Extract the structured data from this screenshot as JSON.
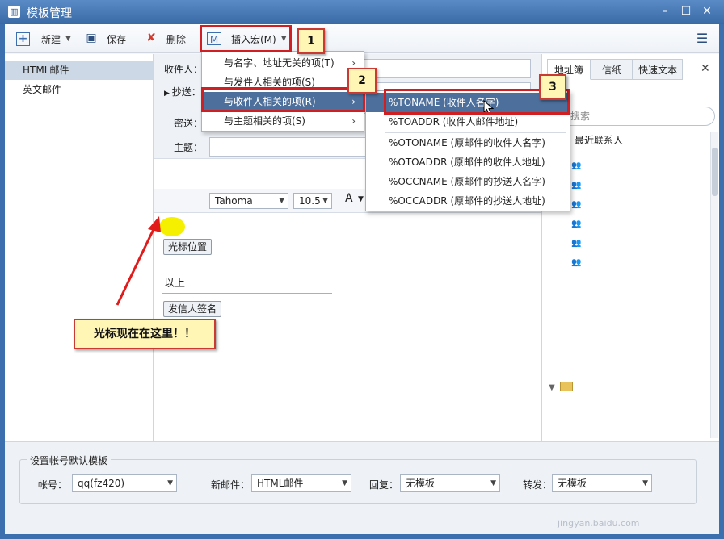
{
  "window": {
    "title": "模板管理"
  },
  "toolbar": {
    "new_label": "新建",
    "save_label": "保存",
    "delete_label": "删除",
    "insert_macro_label": "插入宏(M)"
  },
  "sidebar": {
    "items": [
      {
        "label": "HTML邮件"
      },
      {
        "label": "英文邮件"
      }
    ]
  },
  "compose": {
    "to_label": "收件人：",
    "cc_label": "抄送：",
    "bcc_label": "密送：",
    "subject_label": "主题：",
    "font_name": "Tahoma",
    "font_size": "10.5",
    "cursor_chip": "光标位置",
    "body_text": "以上",
    "signature_chip": "发信人签名"
  },
  "insert_menu": {
    "items": [
      {
        "label": "与名字、地址无关的项(T)"
      },
      {
        "label": "与发件人相关的项(S)"
      },
      {
        "label": "与收件人相关的项(R)"
      },
      {
        "label": "与主题相关的项(S)"
      }
    ]
  },
  "submenu": {
    "items": [
      {
        "label": "%TONAME (收件人名字)"
      },
      {
        "label": "%TOADDR (收件人邮件地址)"
      },
      {
        "label": "%OTONAME (原邮件的收件人名字)"
      },
      {
        "label": "%OTOADDR (原邮件的收件人地址)"
      },
      {
        "label": "%OCCNAME (原邮件的抄送人名字)"
      },
      {
        "label": "%OCCADDR (原邮件的抄送人地址)"
      }
    ]
  },
  "addressbook": {
    "tabs": [
      {
        "label": "地址簿"
      },
      {
        "label": "信纸"
      },
      {
        "label": "快速文本"
      }
    ],
    "search_placeholder": "搜索",
    "recent_contacts": "最近联系人"
  },
  "bottom": {
    "group_title": "设置帐号默认模板",
    "account_label": "帐号：",
    "account_value": "qq(fz420)",
    "new_mail_label": "新邮件：",
    "new_mail_value": "HTML邮件",
    "reply_label": "回复：",
    "reply_value": "无模板",
    "forward_label": "转发：",
    "forward_value": "无模板"
  },
  "annotations": {
    "step1": "1",
    "step2": "2",
    "step3": "3",
    "cursor_note": "光标现在在这里！！"
  },
  "watermark": {
    "text": "jingyan.baidu.com"
  },
  "colors": {
    "title_bar": "#3a6aa6",
    "menu_highlight": "#4d6f9b",
    "annotation_red": "#d01f22",
    "callout_fill": "#fff6b5",
    "cursor_marker": "#f5f000"
  }
}
